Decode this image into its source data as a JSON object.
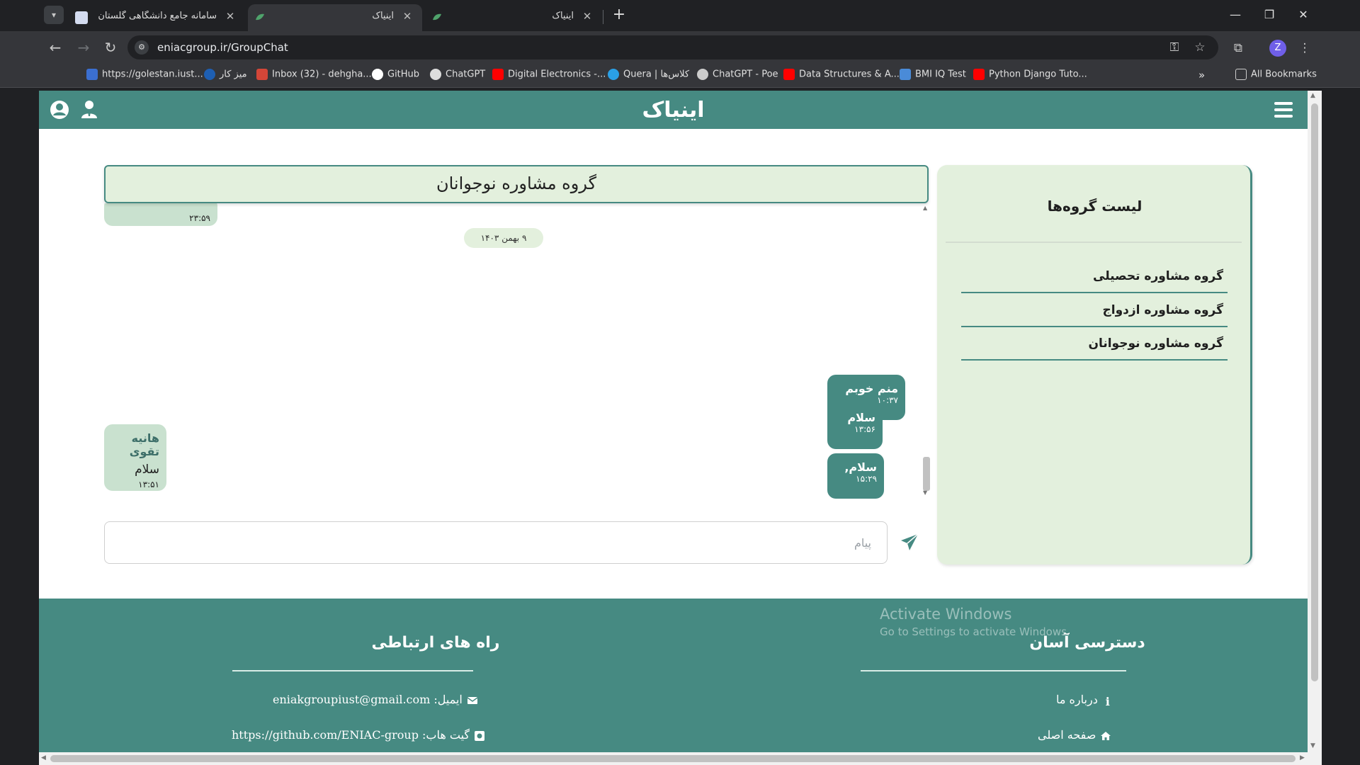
{
  "browser": {
    "tabs": [
      {
        "title": "سامانه جامع دانشگاهی گلستان -",
        "active": false
      },
      {
        "title": "اینیاک",
        "active": true
      },
      {
        "title": "اینیاک",
        "active": false
      }
    ],
    "url": "eniacgroup.ir/GroupChat",
    "bookmarks": [
      {
        "label": "https://golestan.iust...",
        "icon": "golestan-icon",
        "color": "#3b6fd1"
      },
      {
        "label": "میز کار",
        "icon": "quera-dot-icon",
        "color": "#1e5fb3"
      },
      {
        "label": "Inbox (32) - dehgha...",
        "icon": "gmail-icon",
        "color": "#d44638"
      },
      {
        "label": "GitHub",
        "icon": "github-icon",
        "color": "#ffffff"
      },
      {
        "label": "ChatGPT",
        "icon": "chatgpt-icon",
        "color": "#dddddd"
      },
      {
        "label": "Digital Electronics -...",
        "icon": "youtube-icon",
        "color": "#ff0000"
      },
      {
        "label": "Quera | کلاس‌ها",
        "icon": "quera-icon",
        "color": "#2aa0e6"
      },
      {
        "label": "ChatGPT - Poe",
        "icon": "poe-icon",
        "color": "#cccccc"
      },
      {
        "label": "Data Structures & A...",
        "icon": "youtube-icon",
        "color": "#ff0000"
      },
      {
        "label": "BMI IQ Test",
        "icon": "bmi-icon",
        "color": "#4a8bd8"
      },
      {
        "label": "Python Django Tuto...",
        "icon": "youtube-icon",
        "color": "#ff0000"
      }
    ],
    "all_bookmarks": "All Bookmarks",
    "profile_initial": "Z"
  },
  "site": {
    "title": "اینیاک",
    "accent": "#468a82",
    "panel_bg": "#e3f0dd"
  },
  "chat": {
    "group_title": "گروه مشاوره نوجوانان",
    "date_chip": "۹ بهمن ۱۴۰۳",
    "messages": [
      {
        "kind": "in",
        "sender": "",
        "text": "",
        "time": "۲۳:۵۹",
        "partial": true
      },
      {
        "kind": "out",
        "sender": "منم خوبم",
        "text": "",
        "time": "۱۰:۳۷"
      },
      {
        "kind": "in",
        "sender": "هانیه تقوی",
        "text": "سلام",
        "time": "۱۳:۵۱"
      },
      {
        "kind": "out",
        "sender": "سلام",
        "text": "",
        "time": "۱۳:۵۶"
      },
      {
        "kind": "out",
        "sender": "سلام,",
        "text": "",
        "time": "۱۵:۲۹"
      }
    ],
    "input_placeholder": "پیام"
  },
  "groups": {
    "title": "لیست گروه‌ها",
    "items": [
      "گروه مشاوره تحصیلی",
      "گروه مشاوره ازدواج",
      "گروه مشاوره نوجوانان"
    ]
  },
  "footer": {
    "quick_access_title": "دسترسی آسان",
    "contact_title": "راه های ارتباطی",
    "about": "درباره ما",
    "home": "صفحه اصلی",
    "email": "ایمیل: eniakgroupiust@gmail.com",
    "github": "گیت هاب: https://github.com/ENIAC-group"
  },
  "watermark": {
    "line1": "Activate Windows",
    "line2": "Go to Settings to activate Windows."
  }
}
